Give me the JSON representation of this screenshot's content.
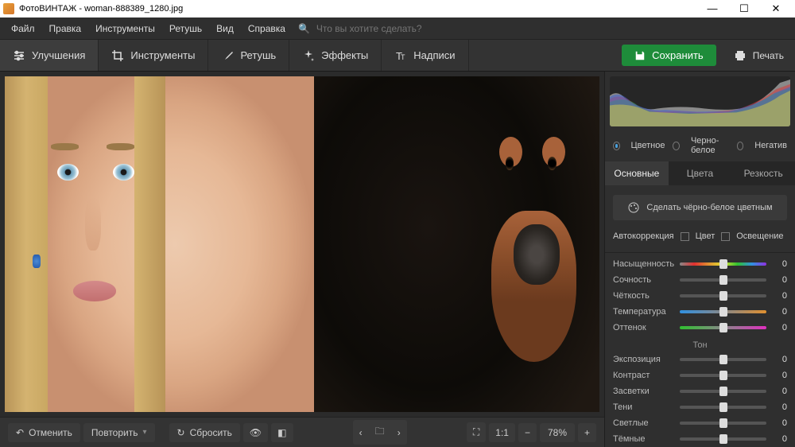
{
  "title": "ФотоВИНТАЖ - woman-888389_1280.jpg",
  "menu": [
    "Файл",
    "Правка",
    "Инструменты",
    "Ретушь",
    "Вид",
    "Справка"
  ],
  "search_placeholder": "Что вы хотите сделать?",
  "tabs": {
    "improve": "Улучшения",
    "tools": "Инструменты",
    "retouch": "Ретушь",
    "effects": "Эффекты",
    "captions": "Надписи"
  },
  "actions": {
    "save": "Сохранить",
    "print": "Печать"
  },
  "bottom": {
    "undo": "Отменить",
    "redo": "Повторить",
    "reset": "Сбросить",
    "zoom": "78%",
    "ratio": "1:1"
  },
  "histogram_modes": {
    "color": "Цветное",
    "bw": "Черно-белое",
    "negative": "Негатив"
  },
  "prop_tabs": {
    "main": "Основные",
    "colors": "Цвета",
    "sharp": "Резкость"
  },
  "bw_button": "Сделать чёрно-белое цветным",
  "autocorrect": {
    "label": "Автокоррекция",
    "color": "Цвет",
    "light": "Освещение"
  },
  "sliders": {
    "saturation": {
      "label": "Насыщенность",
      "val": "0"
    },
    "vibrance": {
      "label": "Сочность",
      "val": "0"
    },
    "clarity": {
      "label": "Чёткость",
      "val": "0"
    },
    "temperature": {
      "label": "Температура",
      "val": "0"
    },
    "tint": {
      "label": "Оттенок",
      "val": "0"
    }
  },
  "tone_title": "Тон",
  "tone": {
    "exposure": {
      "label": "Экспозиция",
      "val": "0"
    },
    "contrast": {
      "label": "Контраст",
      "val": "0"
    },
    "highlights": {
      "label": "Засветки",
      "val": "0"
    },
    "shadows": {
      "label": "Тени",
      "val": "0"
    },
    "whites": {
      "label": "Светлые",
      "val": "0"
    },
    "blacks": {
      "label": "Тёмные",
      "val": "0"
    }
  }
}
